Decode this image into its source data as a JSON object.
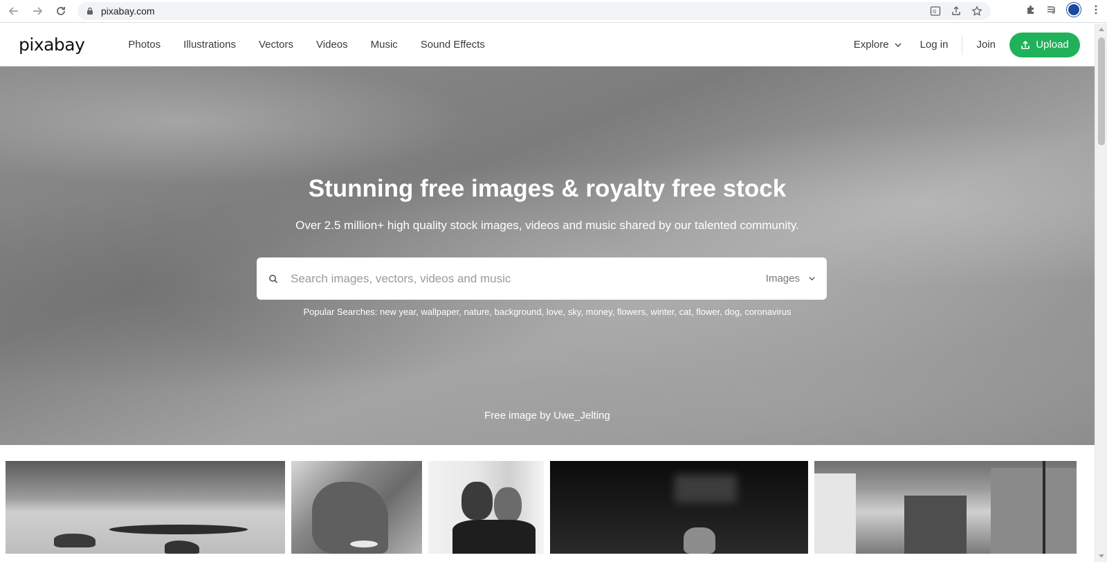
{
  "browser": {
    "url": "pixabay.com"
  },
  "header": {
    "logo": "pixabay",
    "nav": [
      "Photos",
      "Illustrations",
      "Vectors",
      "Videos",
      "Music",
      "Sound Effects"
    ],
    "explore_label": "Explore",
    "login_label": "Log in",
    "join_label": "Join",
    "upload_label": "Upload"
  },
  "hero": {
    "title": "Stunning free images & royalty free stock",
    "subtitle": "Over 2.5 million+ high quality stock images, videos and music shared by our talented community.",
    "search_placeholder": "Search images, vectors, videos and music",
    "search_scope": "Images",
    "popular_label": "Popular Searches:",
    "popular_tags": [
      "new year",
      "wallpaper",
      "nature",
      "background",
      "love",
      "sky",
      "money",
      "flowers",
      "winter",
      "cat",
      "flower",
      "dog",
      "coronavirus"
    ],
    "credit": "Free image by Uwe_Jelting"
  },
  "colors": {
    "upload_green": "#20b15a",
    "profile_blue": "#1a4b9c"
  },
  "icons": {
    "back": "arrow-left-icon",
    "forward": "arrow-right-icon",
    "reload": "reload-icon",
    "lock": "lock-icon",
    "translate": "translate-icon",
    "share": "share-icon",
    "bookmark": "star-icon",
    "extensions": "puzzle-icon",
    "media": "media-queue-icon",
    "menu": "kebab-menu-icon",
    "search": "search-icon",
    "chevron": "chevron-down-icon",
    "upload": "upload-icon"
  }
}
